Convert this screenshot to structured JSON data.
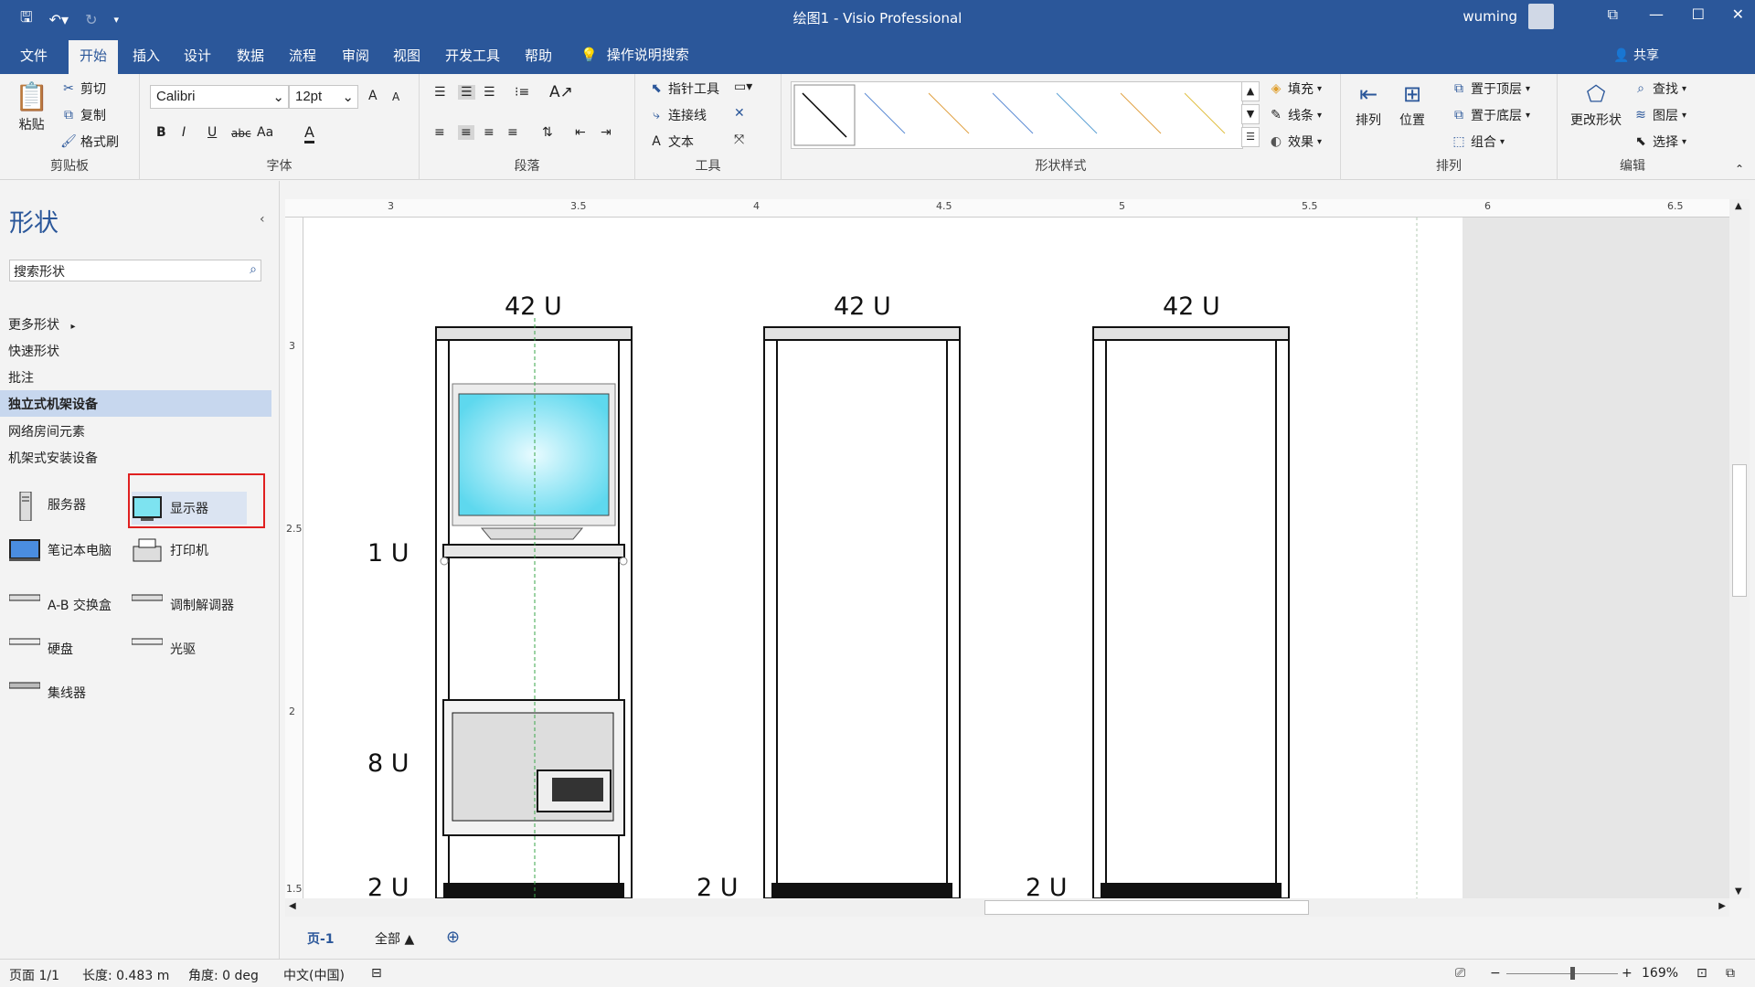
{
  "window": {
    "title": "绘图1  -  Visio Professional",
    "user": "wuming",
    "controls": [
      "⧉",
      "—",
      "☐",
      "✕"
    ]
  },
  "menu": {
    "tabs": [
      "文件",
      "开始",
      "插入",
      "设计",
      "数据",
      "流程",
      "审阅",
      "视图",
      "开发工具",
      "帮助"
    ],
    "active": "开始",
    "tell_me": "操作说明搜索",
    "share": "共享"
  },
  "ribbon": {
    "clipboard": {
      "paste": "粘贴",
      "cut": "剪切",
      "copy": "复制",
      "format_painter": "格式刷",
      "label": "剪贴板"
    },
    "font": {
      "family": "Calibri",
      "size": "12pt",
      "bold": "B",
      "italic": "I",
      "underline": "U",
      "strike": "abc",
      "case": "Aa",
      "color": "A",
      "grow": "A",
      "shrink": "A",
      "label": "字体"
    },
    "paragraph": {
      "label": "段落"
    },
    "tools": {
      "pointer": "指针工具",
      "connector": "连接线",
      "text": "文本",
      "label": "工具"
    },
    "shape_styles": {
      "fill": "填充",
      "line": "线条",
      "effects": "效果",
      "label": "形状样式"
    },
    "arrange": {
      "arrange": "排列",
      "position": "位置",
      "bring_front": "置于顶层",
      "send_back": "置于底层",
      "group": "组合",
      "label": "排列"
    },
    "editing": {
      "change_shape": "更改形状",
      "find": "查找",
      "layers": "图层",
      "select": "选择",
      "label": "编辑"
    }
  },
  "shapes_pane": {
    "title": "形状",
    "search_placeholder": "搜索形状",
    "stencils": [
      "更多形状",
      "快速形状",
      "批注",
      "独立式机架设备",
      "网络房间元素",
      "机架式安装设备"
    ],
    "selected_stencil": "独立式机架设备",
    "items": [
      "服务器",
      "显示器",
      "笔记本电脑",
      "打印机",
      "A-B 交换盒",
      "调制解调器",
      "硬盘",
      "光驱",
      "集线器"
    ]
  },
  "ruler": {
    "top": [
      "3",
      "3.5",
      "4",
      "4.5",
      "5",
      "5.5",
      "6",
      "6.5"
    ],
    "left": [
      "3",
      "2.5",
      "2",
      "1.5"
    ]
  },
  "drawing": {
    "rack_labels": [
      "42 U",
      "42 U",
      "42 U"
    ],
    "side_labels": [
      "1 U",
      "8 U",
      "2 U",
      "2 U",
      "2 U"
    ]
  },
  "page_tabs": {
    "page": "页-1",
    "all": "全部 ▲",
    "add": "⊕"
  },
  "status": {
    "page": "页面 1/1",
    "length": "长度: 0.483 m",
    "angle": "角度: 0 deg",
    "language": "中文(中国)",
    "zoom": "169%"
  }
}
